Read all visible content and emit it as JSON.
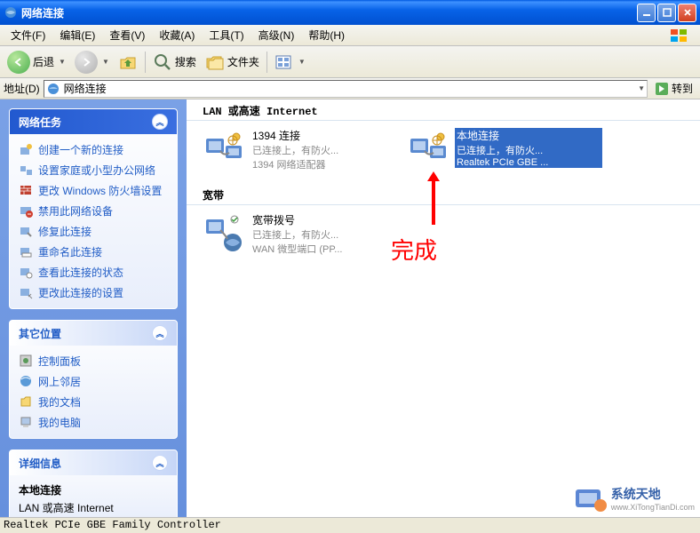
{
  "window": {
    "title": "网络连接"
  },
  "menubar": {
    "file": "文件(F)",
    "edit": "编辑(E)",
    "view": "查看(V)",
    "favorites": "收藏(A)",
    "tools": "工具(T)",
    "advanced": "高级(N)",
    "help": "帮助(H)"
  },
  "toolbar": {
    "back": "后退",
    "search": "搜索",
    "folders": "文件夹"
  },
  "addressbar": {
    "label": "地址(D)",
    "value": "网络连接",
    "go": "转到"
  },
  "sidebar": {
    "tasks_panel_title": "网络任务",
    "tasks": [
      {
        "label": "创建一个新的连接"
      },
      {
        "label": "设置家庭或小型办公网络"
      },
      {
        "label": "更改 Windows 防火墙设置"
      },
      {
        "label": "禁用此网络设备"
      },
      {
        "label": "修复此连接"
      },
      {
        "label": "重命名此连接"
      },
      {
        "label": "查看此连接的状态"
      },
      {
        "label": "更改此连接的设置"
      }
    ],
    "other_panel_title": "其它位置",
    "other": [
      {
        "label": "控制面板"
      },
      {
        "label": "网上邻居"
      },
      {
        "label": "我的文档"
      },
      {
        "label": "我的电脑"
      }
    ],
    "details_panel_title": "详细信息",
    "details": {
      "name": "本地连接",
      "type": "LAN 或高速 Internet"
    }
  },
  "content": {
    "groups": [
      {
        "title": "LAN 或高速 Internet",
        "items": [
          {
            "name": "1394 连接",
            "status": "已连接上，有防火...",
            "device": "1394 网络适配器",
            "selected": false
          },
          {
            "name": "本地连接",
            "status": "已连接上，有防火...",
            "device": "Realtek PCIe GBE ...",
            "selected": true
          }
        ]
      },
      {
        "title": "宽带",
        "items": [
          {
            "name": "宽带拨号",
            "status": "已连接上，有防火...",
            "device": "WAN 微型端口 (PP...",
            "selected": false
          }
        ]
      }
    ]
  },
  "annotation": {
    "text": "完成"
  },
  "statusbar": {
    "text": "Realtek PCIe GBE Family Controller"
  },
  "watermark": {
    "brand": "系统天地",
    "url": "www.XiTongTianDi.com"
  }
}
